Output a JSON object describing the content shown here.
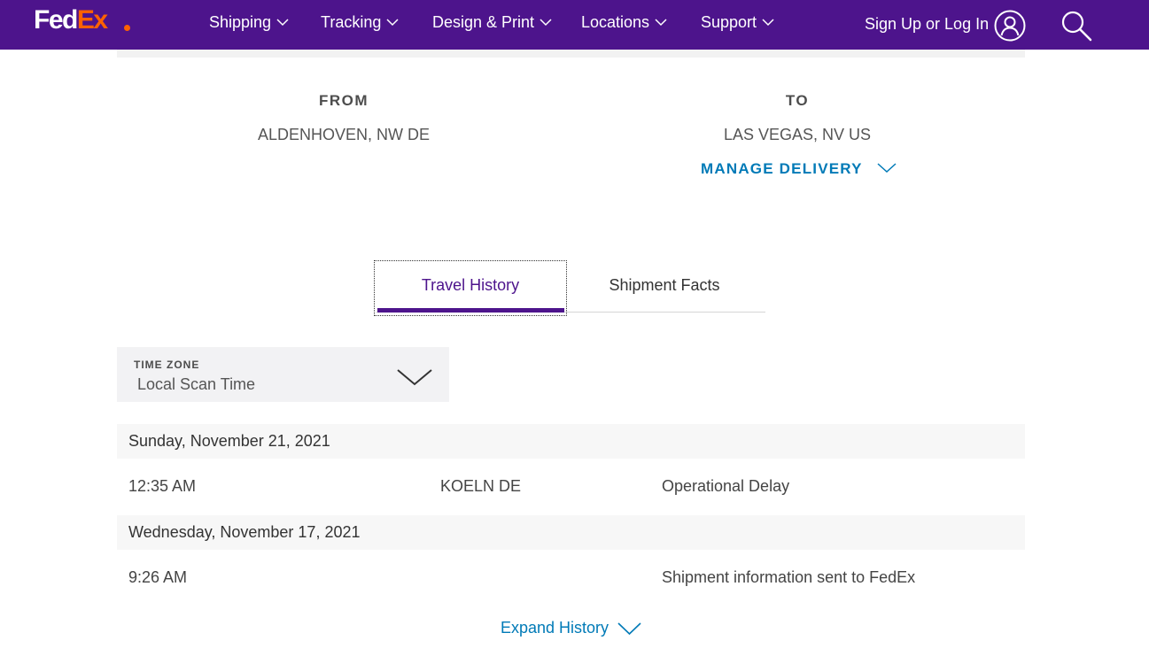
{
  "header": {
    "logo": {
      "fed": "Fed",
      "ex": "Ex"
    },
    "nav": [
      {
        "label": "Shipping"
      },
      {
        "label": "Tracking"
      },
      {
        "label": "Design & Print"
      },
      {
        "label": "Locations"
      },
      {
        "label": "Support"
      }
    ],
    "login_label": "Sign Up or Log In"
  },
  "shipment": {
    "from_label": "FROM",
    "from_value": "ALDENHOVEN, NW DE",
    "to_label": "TO",
    "to_value": "LAS VEGAS, NV US",
    "manage_delivery": "MANAGE DELIVERY"
  },
  "tabs": {
    "travel_history": "Travel History",
    "shipment_facts": "Shipment Facts",
    "active": "travel_history"
  },
  "timezone": {
    "label": "TIME ZONE",
    "value": "Local Scan Time"
  },
  "history": [
    {
      "date": "Sunday, November 21, 2021",
      "events": [
        {
          "time": "12:35 AM",
          "location": "KOELN DE",
          "status": "Operational Delay"
        }
      ]
    },
    {
      "date": "Wednesday, November 17, 2021",
      "events": [
        {
          "time": "9:26 AM",
          "location": "",
          "status": "Shipment information sent to FedEx"
        }
      ]
    }
  ],
  "expand_history": "Expand History",
  "colors": {
    "brand_purple": "#4d148c",
    "brand_orange": "#ff6200",
    "link_blue": "#007ab7"
  }
}
